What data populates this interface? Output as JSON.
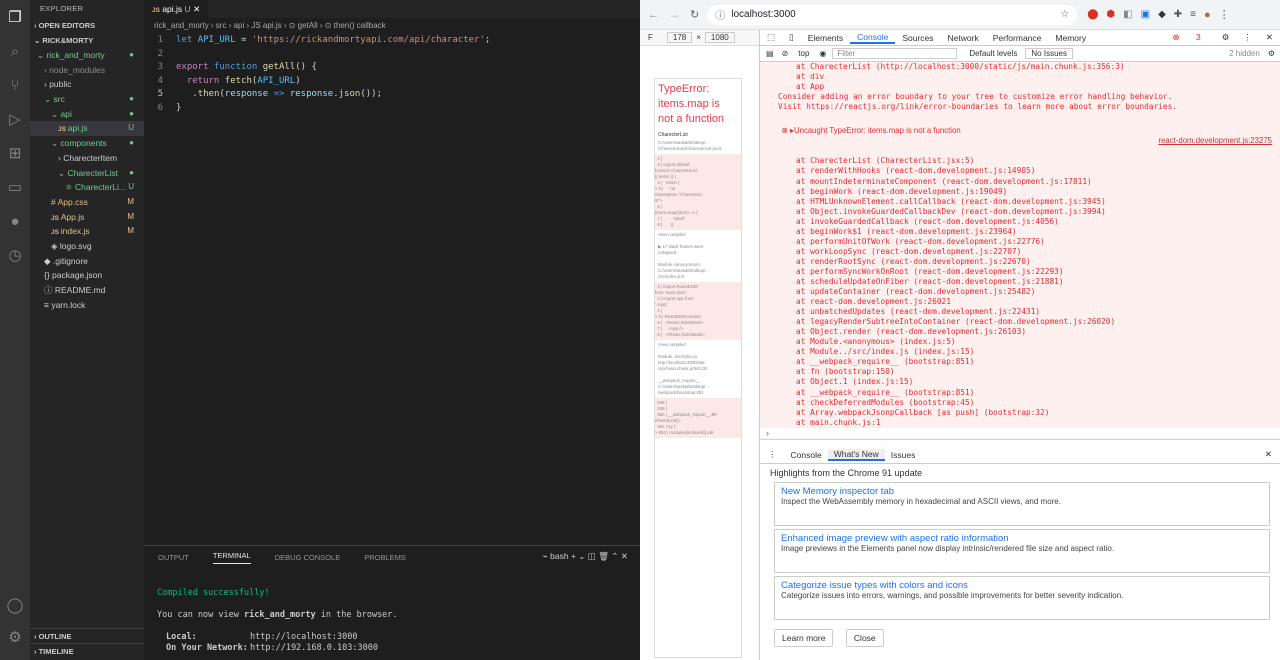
{
  "activity": [
    "explorer-icon",
    "search-icon",
    "source-control-icon",
    "run-debug-icon",
    "extensions-icon",
    "remote-icon",
    "github-icon",
    "timeline-icon"
  ],
  "sidebar": {
    "header": "EXPLORER",
    "open_editors": "OPEN EDITORS",
    "project": "RICK&MORTY",
    "outline": "OUTLINE",
    "timeline": "TIMELINE",
    "tree": [
      {
        "indent": 1,
        "label": "rick_and_morty",
        "badge": "●",
        "arrow": "⌄",
        "color": "#73c991"
      },
      {
        "indent": 2,
        "label": "node_modules",
        "badge": "",
        "arrow": "›",
        "color": "#8c8c8c"
      },
      {
        "indent": 2,
        "label": "public",
        "badge": "",
        "arrow": "›",
        "color": "#ccc"
      },
      {
        "indent": 2,
        "label": "src",
        "badge": "●",
        "arrow": "⌄",
        "color": "#73c991"
      },
      {
        "indent": 3,
        "label": "api",
        "badge": "●",
        "arrow": "⌄",
        "color": "#73c991"
      },
      {
        "indent": 4,
        "label": "api.js",
        "badge": "U",
        "icon": "JS",
        "color": "#73c991",
        "sel": true
      },
      {
        "indent": 3,
        "label": "components",
        "badge": "●",
        "arrow": "⌄",
        "color": "#73c991"
      },
      {
        "indent": 4,
        "label": "CharecterItem",
        "badge": "",
        "arrow": "›",
        "color": "#ccc"
      },
      {
        "indent": 4,
        "label": "CharecterList",
        "badge": "●",
        "arrow": "⌄",
        "color": "#73c991"
      },
      {
        "indent": 5,
        "label": "CharecterLi...",
        "badge": "U",
        "icon": "⚛",
        "color": "#73c991"
      },
      {
        "indent": 3,
        "label": "App.css",
        "badge": "M",
        "icon": "#",
        "color": "#e2c08d"
      },
      {
        "indent": 3,
        "label": "App.js",
        "badge": "M",
        "icon": "JS",
        "color": "#e2c08d"
      },
      {
        "indent": 3,
        "label": "index.js",
        "badge": "M",
        "icon": "JS",
        "color": "#e2c08d"
      },
      {
        "indent": 3,
        "label": "logo.svg",
        "badge": "",
        "icon": "◈",
        "color": "#ccc"
      },
      {
        "indent": 2,
        "label": ".gitignore",
        "badge": "",
        "icon": "◆",
        "color": "#ccc"
      },
      {
        "indent": 2,
        "label": "package.json",
        "badge": "",
        "icon": "{}",
        "color": "#ccc"
      },
      {
        "indent": 2,
        "label": "README.md",
        "badge": "",
        "icon": "ⓘ",
        "color": "#ccc"
      },
      {
        "indent": 2,
        "label": "yarn.lock",
        "badge": "",
        "icon": "≡",
        "color": "#ccc"
      }
    ]
  },
  "editor": {
    "tab": {
      "label": "api.js",
      "status": "U"
    },
    "breadcrumb": "rick_and_morty › src › api › JS api.js › ⊙ getAll › ⊙ then() callback",
    "lines": [
      [
        [
          "let ",
          "kw"
        ],
        [
          "API_URL",
          "ct"
        ],
        [
          " = ",
          "tx"
        ],
        [
          "'https://rickandmortyapi.com/api/character'",
          "st"
        ],
        [
          ";",
          "tx"
        ]
      ],
      [],
      [
        [
          "export ",
          "pc"
        ],
        [
          "function ",
          "kw"
        ],
        [
          "getAll",
          "fn"
        ],
        [
          "() {",
          "tx"
        ]
      ],
      [
        [
          "  return ",
          "pc"
        ],
        [
          "fetch",
          "fn"
        ],
        [
          "(",
          "tx"
        ],
        [
          "API_URL",
          "ct"
        ],
        [
          ")",
          "tx"
        ]
      ],
      [
        [
          "   .",
          "tx"
        ],
        [
          "then",
          "fn"
        ],
        [
          "(",
          "tx"
        ],
        [
          "response",
          "vr"
        ],
        [
          " => ",
          "kw"
        ],
        [
          "response",
          "vr"
        ],
        [
          ".",
          "tx"
        ],
        [
          "json",
          "fn"
        ],
        [
          "());",
          "tx"
        ]
      ],
      [
        [
          "}",
          "tx"
        ]
      ]
    ]
  },
  "panel": {
    "tabs": [
      "OUTPUT",
      "TERMINAL",
      "DEBUG CONSOLE",
      "PROBLEMS"
    ],
    "active": "TERMINAL",
    "shell": "bash",
    "compiled": "Compiled successfully!",
    "view_pre": "You can now view ",
    "app_name": "rick_and_morty",
    "view_post": " in the browser.",
    "local_label": "Local:",
    "local_url": "http://localhost:3000",
    "net_label": "On Your Network:",
    "net_url": "http://192.168.0.103:3000"
  },
  "chrome": {
    "url": "localhost:3000",
    "dims": {
      "w": "178",
      "h": "1080",
      "f": "F"
    },
    "dvtabs": [
      "Elements",
      "Console",
      "Sources",
      "Network",
      "Performance",
      "Memory"
    ],
    "active": "Console",
    "errors": "3",
    "toolbar": {
      "context": "top",
      "filter": "Filter",
      "levels": "Default levels",
      "issues": "No Issues",
      "hidden": "2 hidden"
    },
    "overlay": {
      "title": "TypeError: items.map is not a function",
      "frame": "CharecterList"
    },
    "console": {
      "head": [
        "at CharecterList (http://localhost:3000/static/js/main.chunk.js:356:3)",
        "at div",
        "at App",
        "",
        "Consider adding an error boundary to your tree to customize error handling behavior.",
        "Visit https://reactjs.org/link/error-boundaries to learn more about error boundaries."
      ],
      "error": "Uncaught TypeError: items.map is not a function",
      "error_src": "react-dom.development.js:23275",
      "stack": [
        "at CharecterList (CharecterList.jsx:5)",
        "at renderWithHooks (react-dom.development.js:14985)",
        "at mountIndeterminateComponent (react-dom.development.js:17811)",
        "at beginWork (react-dom.development.js:19049)",
        "at HTMLUnknownElement.callCallback (react-dom.development.js:3945)",
        "at Object.invokeGuardedCallbackDev (react-dom.development.js:3994)",
        "at invokeGuardedCallback (react-dom.development.js:4056)",
        "at beginWork$1 (react-dom.development.js:23964)",
        "at performUnitOfWork (react-dom.development.js:22776)",
        "at workLoopSync (react-dom.development.js:22707)",
        "at renderRootSync (react-dom.development.js:22670)",
        "at performSyncWorkOnRoot (react-dom.development.js:22293)",
        "at scheduleUpdateOnFiber (react-dom.development.js:21881)",
        "at updateContainer (react-dom.development.js:25482)",
        "at react-dom.development.js:26021",
        "at unbatchedUpdates (react-dom.development.js:22431)",
        "at legacyRenderSubtreeIntoContainer (react-dom.development.js:26020)",
        "at Object.render (react-dom.development.js:26103)",
        "at Module.<anonymous> (index.js:5)",
        "at Module../src/index.js (index.js:15)",
        "at __webpack_require__ (bootstrap:851)",
        "at fn (bootstrap:150)",
        "at Object.1 (index.js:15)",
        "at __webpack_require__ (bootstrap:851)",
        "at checkDeferredModules (bootstrap:45)",
        "at Array.webpackJsonpCallback [as push] (bootstrap:32)",
        "at main.chunk.js:1"
      ]
    },
    "drawer": {
      "tabs": [
        "Console",
        "What's New",
        "Issues"
      ],
      "active": "What's New",
      "highlights": "Highlights from the Chrome 91 update",
      "cards": [
        {
          "title": "New Memory inspector tab",
          "desc": "Inspect the WebAssembly memory in hexadecimal and ASCII views, and more."
        },
        {
          "title": "Enhanced image preview with aspect ratio information",
          "desc": "Image previews in the Elements panel now display intrinsic/rendered file size and aspect ratio."
        },
        {
          "title": "Categorize issue types with colors and icons",
          "desc": "Categorize issues into errors, warnings, and possible improvements for better severity indication."
        }
      ],
      "learn": "Learn more",
      "close": "Close"
    }
  }
}
